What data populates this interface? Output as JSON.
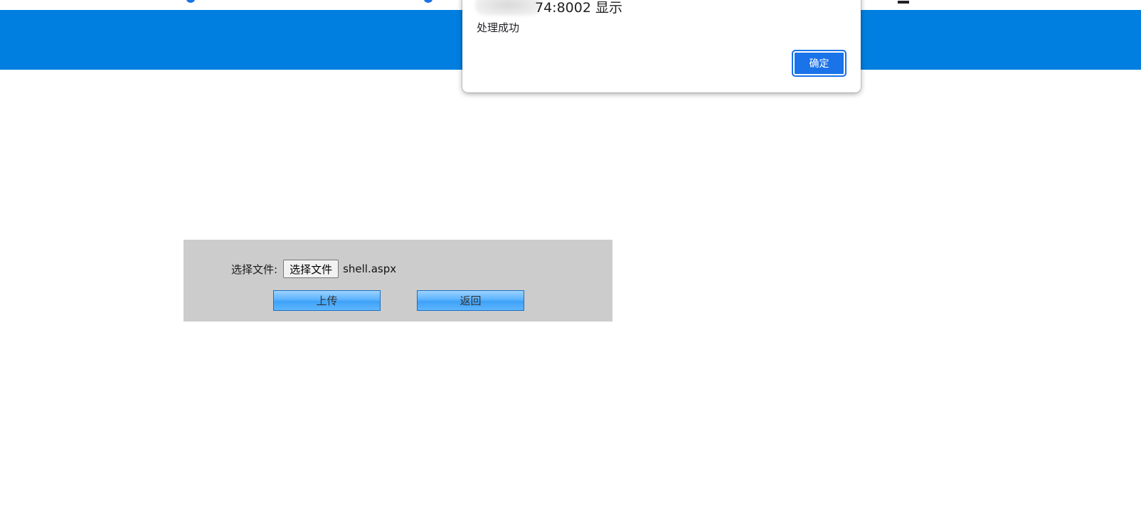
{
  "browser": {
    "background_fragment_color": "#1a73e8"
  },
  "header": {
    "color": "#007fe0"
  },
  "alert": {
    "origin_text": "74:8002 显示",
    "message": "处理成功",
    "ok_label": "确定"
  },
  "upload_form": {
    "file_label": "选择文件:",
    "choose_button_label": "选择文件",
    "file_name": "shell.aspx",
    "upload_button_label": "上传",
    "back_button_label": "返回"
  }
}
